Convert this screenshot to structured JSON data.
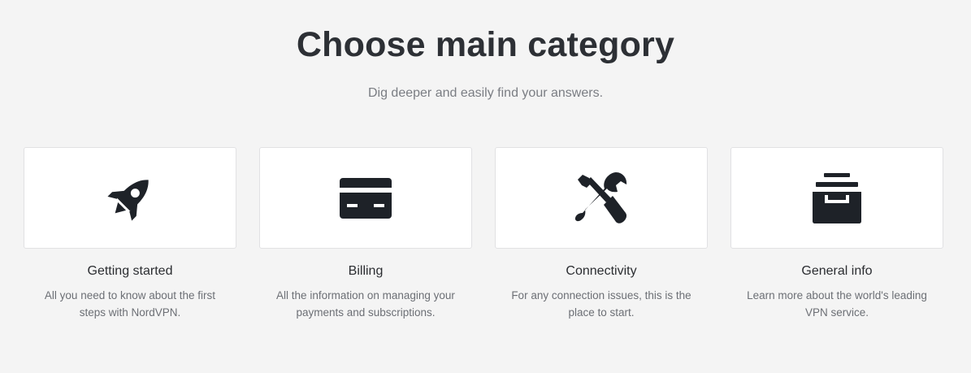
{
  "header": {
    "title": "Choose main category",
    "subtitle": "Dig deeper and easily find your answers."
  },
  "categories": [
    {
      "icon": "rocket-icon",
      "title": "Getting started",
      "description": "All you need to know about the first steps with NordVPN."
    },
    {
      "icon": "credit-card-icon",
      "title": "Billing",
      "description": "All the information on managing your payments and subscriptions."
    },
    {
      "icon": "tools-icon",
      "title": "Connectivity",
      "description": "For any connection issues, this is the place to start."
    },
    {
      "icon": "archive-icon",
      "title": "General info",
      "description": "Learn more about the world's leading VPN service."
    }
  ],
  "colors": {
    "background": "#f4f4f4",
    "card_background": "#ffffff",
    "icon": "#1e2228",
    "title_text": "#2d3035",
    "muted_text": "#6c6f75"
  }
}
